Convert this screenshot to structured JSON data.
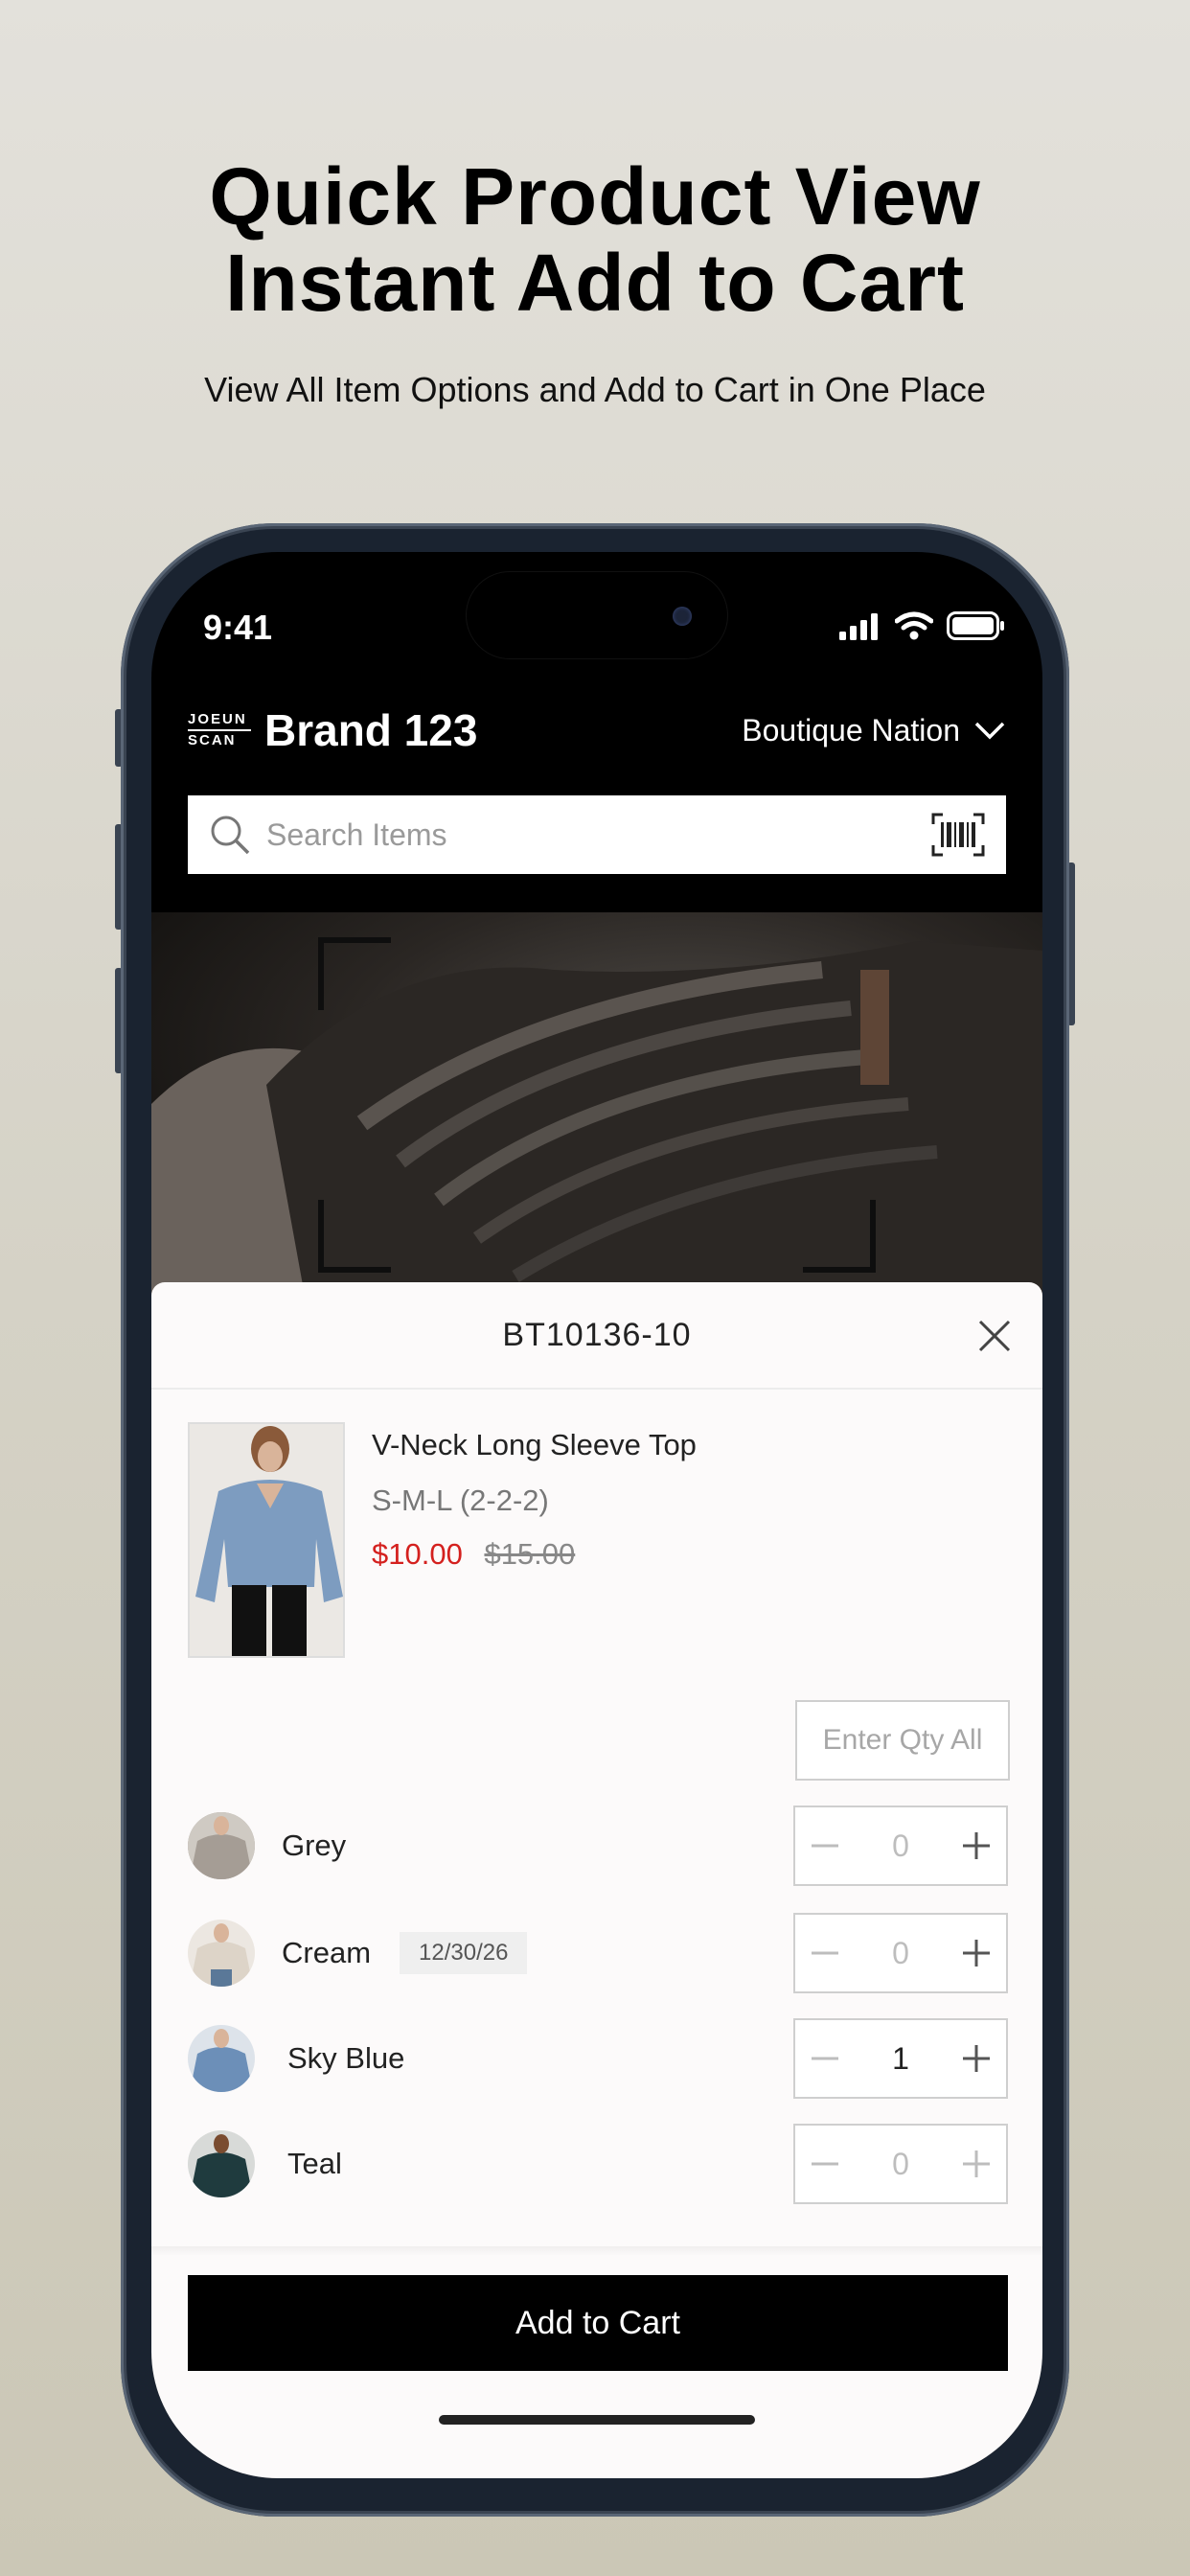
{
  "promo": {
    "headline_line1": "Quick Product View",
    "headline_line2": "Instant Add to Cart",
    "subheadline": "View All Item Options and Add to Cart in One Place"
  },
  "status_bar": {
    "time": "9:41",
    "icons": [
      "signal-icon",
      "wifi-icon",
      "battery-icon"
    ]
  },
  "header": {
    "logo_top": "JOEUN",
    "logo_bottom": "SCAN",
    "brand": "Brand 123",
    "store": "Boutique Nation"
  },
  "search": {
    "placeholder": "Search Items",
    "scan_icon": "barcode-scan-icon"
  },
  "sheet": {
    "sku": "BT10136-10",
    "product": {
      "name": "V-Neck Long Sleeve Top",
      "size_run": "S-M-L (2-2-2)",
      "sale_price": "$10.00",
      "original_price": "$15.00"
    },
    "qty_all_placeholder": "Enter Qty All",
    "variants": [
      {
        "name": "Grey",
        "date": "",
        "qty": "0",
        "color": "#a59d95"
      },
      {
        "name": "Cream",
        "date": "12/30/26",
        "qty": "0",
        "color": "#ddd4c8"
      },
      {
        "name": "Sky Blue",
        "date": "",
        "qty": "1",
        "color": "#6c8fb8"
      },
      {
        "name": "Teal",
        "date": "",
        "qty": "0",
        "color": "#1f3b3e"
      }
    ],
    "add_to_cart": "Add to Cart"
  },
  "colors": {
    "sale": "#d4201e",
    "primary_button": "#000000"
  }
}
